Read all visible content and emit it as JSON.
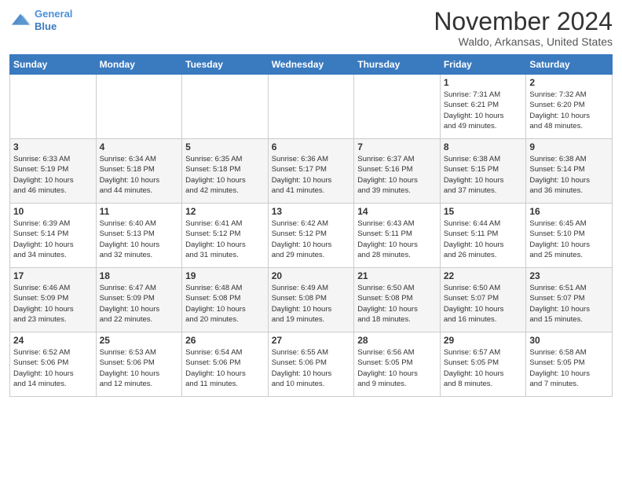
{
  "logo": {
    "line1": "General",
    "line2": "Blue"
  },
  "title": "November 2024",
  "location": "Waldo, Arkansas, United States",
  "weekdays": [
    "Sunday",
    "Monday",
    "Tuesday",
    "Wednesday",
    "Thursday",
    "Friday",
    "Saturday"
  ],
  "weeks": [
    [
      {
        "day": "",
        "info": ""
      },
      {
        "day": "",
        "info": ""
      },
      {
        "day": "",
        "info": ""
      },
      {
        "day": "",
        "info": ""
      },
      {
        "day": "",
        "info": ""
      },
      {
        "day": "1",
        "info": "Sunrise: 7:31 AM\nSunset: 6:21 PM\nDaylight: 10 hours\nand 49 minutes."
      },
      {
        "day": "2",
        "info": "Sunrise: 7:32 AM\nSunset: 6:20 PM\nDaylight: 10 hours\nand 48 minutes."
      }
    ],
    [
      {
        "day": "3",
        "info": "Sunrise: 6:33 AM\nSunset: 5:19 PM\nDaylight: 10 hours\nand 46 minutes."
      },
      {
        "day": "4",
        "info": "Sunrise: 6:34 AM\nSunset: 5:18 PM\nDaylight: 10 hours\nand 44 minutes."
      },
      {
        "day": "5",
        "info": "Sunrise: 6:35 AM\nSunset: 5:18 PM\nDaylight: 10 hours\nand 42 minutes."
      },
      {
        "day": "6",
        "info": "Sunrise: 6:36 AM\nSunset: 5:17 PM\nDaylight: 10 hours\nand 41 minutes."
      },
      {
        "day": "7",
        "info": "Sunrise: 6:37 AM\nSunset: 5:16 PM\nDaylight: 10 hours\nand 39 minutes."
      },
      {
        "day": "8",
        "info": "Sunrise: 6:38 AM\nSunset: 5:15 PM\nDaylight: 10 hours\nand 37 minutes."
      },
      {
        "day": "9",
        "info": "Sunrise: 6:38 AM\nSunset: 5:14 PM\nDaylight: 10 hours\nand 36 minutes."
      }
    ],
    [
      {
        "day": "10",
        "info": "Sunrise: 6:39 AM\nSunset: 5:14 PM\nDaylight: 10 hours\nand 34 minutes."
      },
      {
        "day": "11",
        "info": "Sunrise: 6:40 AM\nSunset: 5:13 PM\nDaylight: 10 hours\nand 32 minutes."
      },
      {
        "day": "12",
        "info": "Sunrise: 6:41 AM\nSunset: 5:12 PM\nDaylight: 10 hours\nand 31 minutes."
      },
      {
        "day": "13",
        "info": "Sunrise: 6:42 AM\nSunset: 5:12 PM\nDaylight: 10 hours\nand 29 minutes."
      },
      {
        "day": "14",
        "info": "Sunrise: 6:43 AM\nSunset: 5:11 PM\nDaylight: 10 hours\nand 28 minutes."
      },
      {
        "day": "15",
        "info": "Sunrise: 6:44 AM\nSunset: 5:11 PM\nDaylight: 10 hours\nand 26 minutes."
      },
      {
        "day": "16",
        "info": "Sunrise: 6:45 AM\nSunset: 5:10 PM\nDaylight: 10 hours\nand 25 minutes."
      }
    ],
    [
      {
        "day": "17",
        "info": "Sunrise: 6:46 AM\nSunset: 5:09 PM\nDaylight: 10 hours\nand 23 minutes."
      },
      {
        "day": "18",
        "info": "Sunrise: 6:47 AM\nSunset: 5:09 PM\nDaylight: 10 hours\nand 22 minutes."
      },
      {
        "day": "19",
        "info": "Sunrise: 6:48 AM\nSunset: 5:08 PM\nDaylight: 10 hours\nand 20 minutes."
      },
      {
        "day": "20",
        "info": "Sunrise: 6:49 AM\nSunset: 5:08 PM\nDaylight: 10 hours\nand 19 minutes."
      },
      {
        "day": "21",
        "info": "Sunrise: 6:50 AM\nSunset: 5:08 PM\nDaylight: 10 hours\nand 18 minutes."
      },
      {
        "day": "22",
        "info": "Sunrise: 6:50 AM\nSunset: 5:07 PM\nDaylight: 10 hours\nand 16 minutes."
      },
      {
        "day": "23",
        "info": "Sunrise: 6:51 AM\nSunset: 5:07 PM\nDaylight: 10 hours\nand 15 minutes."
      }
    ],
    [
      {
        "day": "24",
        "info": "Sunrise: 6:52 AM\nSunset: 5:06 PM\nDaylight: 10 hours\nand 14 minutes."
      },
      {
        "day": "25",
        "info": "Sunrise: 6:53 AM\nSunset: 5:06 PM\nDaylight: 10 hours\nand 12 minutes."
      },
      {
        "day": "26",
        "info": "Sunrise: 6:54 AM\nSunset: 5:06 PM\nDaylight: 10 hours\nand 11 minutes."
      },
      {
        "day": "27",
        "info": "Sunrise: 6:55 AM\nSunset: 5:06 PM\nDaylight: 10 hours\nand 10 minutes."
      },
      {
        "day": "28",
        "info": "Sunrise: 6:56 AM\nSunset: 5:05 PM\nDaylight: 10 hours\nand 9 minutes."
      },
      {
        "day": "29",
        "info": "Sunrise: 6:57 AM\nSunset: 5:05 PM\nDaylight: 10 hours\nand 8 minutes."
      },
      {
        "day": "30",
        "info": "Sunrise: 6:58 AM\nSunset: 5:05 PM\nDaylight: 10 hours\nand 7 minutes."
      }
    ]
  ]
}
